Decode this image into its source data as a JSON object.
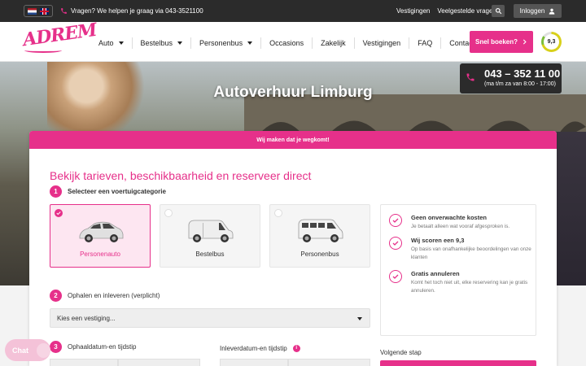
{
  "topbar": {
    "phone_text": "Vragen? We helpen je graag via 043-3521100",
    "links": [
      "Vestigingen",
      "Veelgestelde vragen"
    ],
    "login_label": "Inloggen"
  },
  "nav": {
    "logo_text": "ADREM",
    "items": [
      {
        "label": "Auto",
        "dropdown": true
      },
      {
        "label": "Bestelbus",
        "dropdown": true
      },
      {
        "label": "Personenbus",
        "dropdown": true
      },
      {
        "label": "Occasions",
        "dropdown": false
      },
      {
        "label": "Zakelijk",
        "dropdown": false
      },
      {
        "label": "Vestigingen",
        "dropdown": false
      },
      {
        "label": "FAQ",
        "dropdown": false
      },
      {
        "label": "Contact",
        "dropdown": false
      }
    ],
    "book_label": "Snel boeken?",
    "score": "9,3"
  },
  "hero": {
    "title": "Autoverhuur Limburg",
    "phone_number": "043 – 352 11 00",
    "phone_hours": "(ma t/m za van 8:00 - 17:00)"
  },
  "form": {
    "banner": "Wij maken dat je wegkomt!",
    "title": "Bekijk tarieven, beschikbaarheid en reserveer direct",
    "step1": {
      "num": "1",
      "label": "Selecteer een voertuigcategorie"
    },
    "vehicles": [
      {
        "label": "Personenauto",
        "selected": true
      },
      {
        "label": "Bestelbus",
        "selected": false
      },
      {
        "label": "Personenbus",
        "selected": false
      }
    ],
    "step2": {
      "num": "2",
      "label": "Ophalen en inleveren (verplicht)"
    },
    "location_placeholder": "Kies een vestiging...",
    "step3": {
      "num": "3",
      "label": "Ophaaldatum-en tijdstip"
    },
    "return_label": "Inleverdatum-en tijdstip",
    "next_label": "Volgende stap"
  },
  "benefits": [
    {
      "title": "Geen onverwachte kosten",
      "desc": "Je betaalt alleen wat vooraf afgesproken is."
    },
    {
      "title": "Wij scoren een 9,3",
      "desc": "Op basis van onafhankelijke beoordelingen van onze klanten"
    },
    {
      "title": "Gratis annuleren",
      "desc": "Komt het toch niet uit, elke reservering kan je gratis annuleren."
    }
  ],
  "chat": {
    "label": "Chat"
  },
  "colors": {
    "accent": "#e6308a",
    "dark": "#2b2b2b"
  }
}
